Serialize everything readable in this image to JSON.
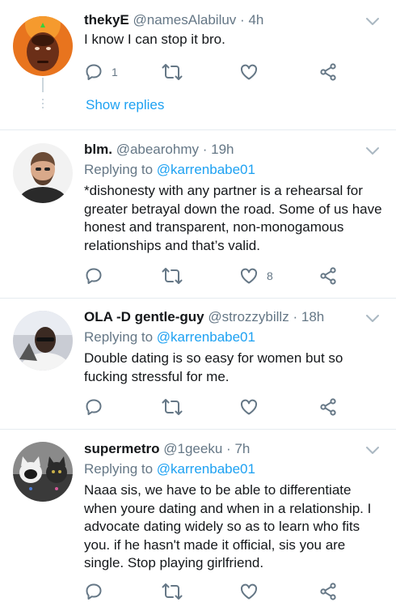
{
  "tweets": [
    {
      "name": "thekyE",
      "handle": "@namesAlabiluv",
      "time": "4h",
      "replying_to_label": "",
      "replying_to": "",
      "text": "I know I can stop it bro.",
      "reply_count": "1",
      "retweet_count": "",
      "like_count": "",
      "show_replies": "Show replies"
    },
    {
      "name": "blm.",
      "handle": "@abearohmy",
      "time": "19h",
      "replying_to_label": "Replying to",
      "replying_to": "@karrenbabe01",
      "text": "*dishonesty with any partner is a rehearsal for greater betrayal down the road. Some of us have honest and transparent, non-monogamous relationships and that’s valid.",
      "reply_count": "",
      "retweet_count": "",
      "like_count": "8"
    },
    {
      "name": "OLA -D gentle-guy",
      "handle": "@strozzybillz",
      "time": "18h",
      "replying_to_label": "Replying to",
      "replying_to": "@karrenbabe01",
      "text": "Double dating is so easy for women but so fucking stressful for me.",
      "reply_count": "",
      "retweet_count": "",
      "like_count": ""
    },
    {
      "name": "supermetro",
      "handle": "@1geeku",
      "time": "7h",
      "replying_to_label": "Replying to",
      "replying_to": "@karrenbabe01",
      "text": "Naaa sis, we have to be able to differentiate when youre dating and when in a relationship. I advocate dating widely so as to learn who fits you. if he hasn't made it official, sis you are single. Stop playing girlfriend.",
      "reply_count": "",
      "retweet_count": "",
      "like_count": ""
    }
  ],
  "separator": "·",
  "icons": {
    "reply": "reply-icon",
    "retweet": "retweet-icon",
    "like": "heart-icon",
    "share": "share-icon",
    "menu": "chevron-down-icon"
  },
  "colors": {
    "link": "#1da1f2",
    "meta": "#657786",
    "text": "#14171a",
    "divider": "#e6ecf0"
  }
}
